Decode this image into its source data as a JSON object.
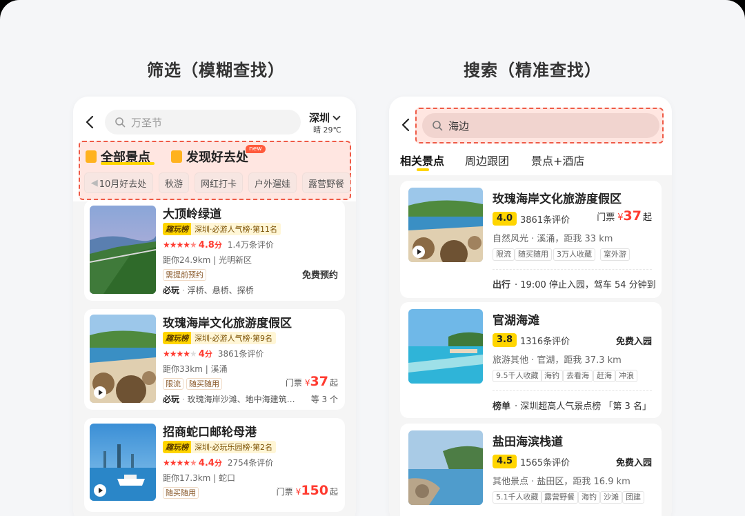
{
  "titles": {
    "left": "筛选（模糊查找）",
    "right": "搜索（精准查找）"
  },
  "left": {
    "search_placeholder": "万圣节",
    "city": "深圳",
    "weather": "晴 29℃",
    "tabs": [
      {
        "label": "全部景点",
        "active": true
      },
      {
        "label": "发现好去处",
        "badge": "new"
      }
    ],
    "chips": [
      "10月好去处",
      "秋游",
      "网红打卡",
      "户外遛娃",
      "露营野餐"
    ],
    "cards": [
      {
        "title": "大顶岭绿道",
        "rank_key": "趣玩榜",
        "rank_text": "深圳·必游人气榜·第11名",
        "stars": 4.5,
        "score": "4.8",
        "score_unit": "分",
        "reviews": "1.4万条评价",
        "distance": "距你24.9km",
        "area": "光明新区",
        "tags": [
          "需提前预约"
        ],
        "right_text": "免费预约",
        "play_label": "必玩",
        "play_text": "浮桥、悬桥、探桥"
      },
      {
        "title": "玫瑰海岸文化旅游度假区",
        "rank_key": "趣玩榜",
        "rank_text": "深圳·必游人气榜·第9名",
        "stars": 4,
        "score": "4",
        "score_unit": "分",
        "reviews": "3861条评价",
        "distance": "距你33km",
        "area": "溪涌",
        "tags": [
          "限流",
          "随买随用"
        ],
        "price_label": "门票",
        "price_yen": "¥",
        "price": "37",
        "price_suffix": "起",
        "play_label": "必玩",
        "play_text": "玫瑰海岸沙滩、地中海建筑…",
        "play_more": "等 3 个"
      },
      {
        "title": "招商蛇口邮轮母港",
        "rank_key": "趣玩榜",
        "rank_text": "深圳·必玩乐园榜·第2名",
        "stars": 4.5,
        "score": "4.4",
        "score_unit": "分",
        "reviews": "2754条评价",
        "distance": "距你17.3km",
        "area": "蛇口",
        "tags": [
          "随买随用"
        ],
        "price_label": "门票",
        "price_yen": "¥",
        "price": "150",
        "price_suffix": "起"
      }
    ]
  },
  "right": {
    "search_value": "海边",
    "tabs": [
      "相关景点",
      "周边跟团",
      "景点+酒店"
    ],
    "cards": [
      {
        "title": "玫瑰海岸文化旅游度假区",
        "score": "4.0",
        "reviews": "3861条评价",
        "price_label": "门票",
        "price_yen": "¥",
        "price": "37",
        "price_suffix": "起",
        "meta": "自然风光 · 溪涌，距我 33 km",
        "tags": [
          "限流",
          "随买随用",
          "3万人收藏",
          "室外游"
        ],
        "info_label": "出行",
        "info_text": "· 19:00 停止入园，驾车 54 分钟到"
      },
      {
        "title": "官湖海滩",
        "score": "3.8",
        "reviews": "1316条评价",
        "right_text": "免费入园",
        "meta": "旅游其他 · 官湖，距我 37.3 km",
        "tags": [
          "9.5千人收藏",
          "海钓",
          "去看海",
          "赶海",
          "冲浪"
        ],
        "info_label": "榜单",
        "info_text": "· 深圳超高人气景点榜 「第 3 名」"
      },
      {
        "title": "盐田海滨栈道",
        "score": "4.5",
        "reviews": "1565条评价",
        "right_text": "免费入园",
        "meta": "其他景点 · 盐田区，距我 16.9 km",
        "tags": [
          "5.1千人收藏",
          "露营野餐",
          "海钓",
          "沙滩",
          "团建"
        ]
      }
    ]
  },
  "colors": {
    "highlight_border": "#ef5a46",
    "accent_yellow": "#ffd500",
    "price_red": "#ff3b30"
  }
}
